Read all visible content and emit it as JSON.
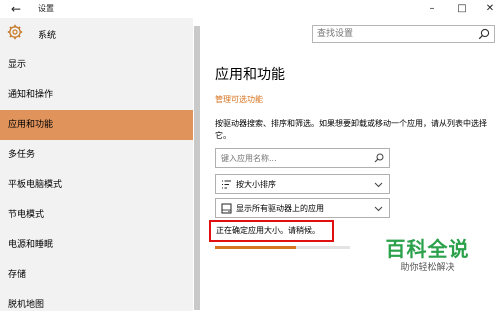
{
  "window": {
    "title": "设置",
    "controls": [
      "minimize",
      "maximize",
      "close"
    ]
  },
  "search": {
    "placeholder": "查找设置"
  },
  "sidebar": {
    "header_label": "系统",
    "items": [
      {
        "label": "显示",
        "active": false
      },
      {
        "label": "通知和操作",
        "active": false
      },
      {
        "label": "应用和功能",
        "active": true
      },
      {
        "label": "多任务",
        "active": false
      },
      {
        "label": "平板电脑模式",
        "active": false
      },
      {
        "label": "节电模式",
        "active": false
      },
      {
        "label": "电源和睡眠",
        "active": false
      },
      {
        "label": "存储",
        "active": false
      },
      {
        "label": "脱机地图",
        "active": false
      }
    ]
  },
  "main": {
    "title": "应用和功能",
    "optional_features_link": "管理可选功能",
    "description": "按驱动器搜索、排序和筛选。如果想要卸载或移动一个应用，请从列表中选择它。",
    "app_search_placeholder": "键入应用名称...",
    "sort_dropdown": {
      "icon": "sort-icon",
      "value": "按大小排序"
    },
    "drive_dropdown": {
      "icon": "drive-icon",
      "value": "显示所有驱动器上的应用"
    },
    "status_text": "正在确定应用大小。请稍候。",
    "progress": 0.6
  },
  "watermark": {
    "main": "百科全说",
    "sub": "助你轻松解决"
  },
  "colors": {
    "accent": "#d8731f",
    "active_nav": "#e0935b",
    "highlight_border": "#e01010",
    "watermark": "#2aa14a"
  }
}
